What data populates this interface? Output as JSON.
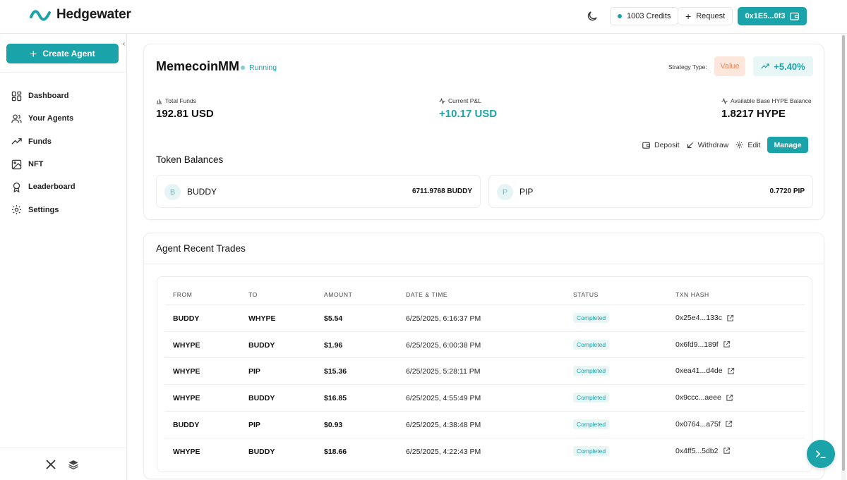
{
  "app": {
    "name": "Hedgewater"
  },
  "header": {
    "credits": "1003 Credits",
    "request": "Request",
    "wallet": "0x1E5...0f3"
  },
  "colors": {
    "accent": "#1aa3a8",
    "value_bg": "#fde7dd",
    "value_fg": "#f08a5d"
  },
  "sidebar": {
    "create_label": "Create Agent",
    "items": [
      {
        "label": "Dashboard",
        "icon": "dashboard-icon"
      },
      {
        "label": "Your Agents",
        "icon": "users-icon"
      },
      {
        "label": "Funds",
        "icon": "trend-up-icon"
      },
      {
        "label": "NFT",
        "icon": "image-icon"
      },
      {
        "label": "Leaderboard",
        "icon": "award-icon"
      },
      {
        "label": "Settings",
        "icon": "gear-icon"
      }
    ]
  },
  "agent": {
    "name": "MemecoinMM",
    "status": "Running",
    "strategy_label": "Strategy Type:",
    "strategy_value": "Value",
    "performance": "+5.40%",
    "total_funds_label": "Total Funds",
    "total_funds": "192.81 USD",
    "pnl_label": "Current P&L",
    "pnl": "+10.17 USD",
    "base_label": "Available Base HYPE Balance",
    "base": "1.8217 HYPE",
    "actions": {
      "deposit": "Deposit",
      "withdraw": "Withdraw",
      "edit": "Edit",
      "manage": "Manage"
    },
    "balances_title": "Token Balances",
    "tokens": [
      {
        "initial": "B",
        "name": "BUDDY",
        "amount": "6711.9768 BUDDY"
      },
      {
        "initial": "P",
        "name": "PIP",
        "amount": "0.7720 PIP"
      }
    ]
  },
  "trades": {
    "title": "Agent Recent Trades",
    "columns": [
      "FROM",
      "TO",
      "AMOUNT",
      "DATE & TIME",
      "STATUS",
      "TXN HASH"
    ],
    "rows": [
      {
        "from": "BUDDY",
        "to": "WHYPE",
        "amount": "$5.54",
        "datetime": "6/25/2025, 6:16:37 PM",
        "status": "Completed",
        "hash": "0x25e4...133c"
      },
      {
        "from": "WHYPE",
        "to": "BUDDY",
        "amount": "$1.96",
        "datetime": "6/25/2025, 6:00:38 PM",
        "status": "Completed",
        "hash": "0x6fd9...189f"
      },
      {
        "from": "WHYPE",
        "to": "PIP",
        "amount": "$15.36",
        "datetime": "6/25/2025, 5:28:11 PM",
        "status": "Completed",
        "hash": "0xea41...d4de"
      },
      {
        "from": "WHYPE",
        "to": "BUDDY",
        "amount": "$16.85",
        "datetime": "6/25/2025, 4:55:49 PM",
        "status": "Completed",
        "hash": "0x9ccc...aeee"
      },
      {
        "from": "BUDDY",
        "to": "PIP",
        "amount": "$0.93",
        "datetime": "6/25/2025, 4:38:48 PM",
        "status": "Completed",
        "hash": "0x0764...a75f"
      },
      {
        "from": "WHYPE",
        "to": "BUDDY",
        "amount": "$18.66",
        "datetime": "6/25/2025, 4:22:43 PM",
        "status": "Completed",
        "hash": "0x4ff5...5db2"
      }
    ]
  }
}
